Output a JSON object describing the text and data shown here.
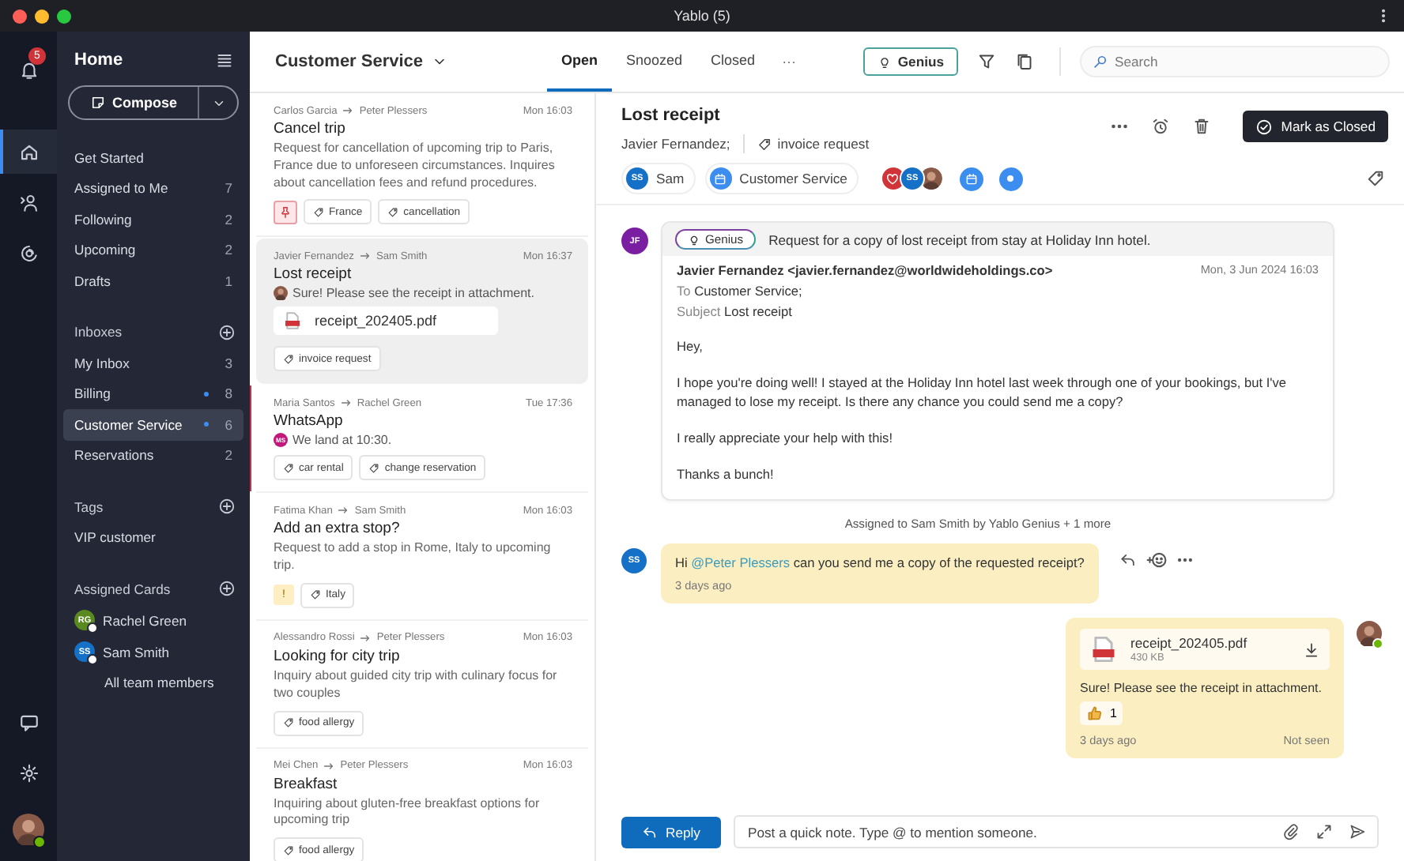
{
  "window": {
    "title": "Yablo (5)"
  },
  "rail": {
    "notifications": "5",
    "items": [
      {
        "kind": "home",
        "selected": true
      },
      {
        "kind": "assign",
        "selected": false
      },
      {
        "kind": "at",
        "selected": false
      }
    ]
  },
  "sidebar": {
    "title": "Home",
    "compose": "Compose",
    "nav": [
      {
        "name": "Get Started",
        "selected": false
      },
      {
        "name": "Assigned to Me",
        "count": "7",
        "selected": false
      },
      {
        "name": "Following",
        "count": "2",
        "selected": false
      },
      {
        "name": "Upcoming",
        "count": "2",
        "selected": false
      },
      {
        "name": "Drafts",
        "count": "1",
        "selected": false
      }
    ],
    "inboxes": {
      "title": "Inboxes",
      "items": [
        {
          "name": "My Inbox",
          "count": "3",
          "unread_dot": false,
          "selected": false
        },
        {
          "name": "Billing",
          "count": "8",
          "unread_dot": true,
          "selected": false
        },
        {
          "name": "Customer Service",
          "count": "6",
          "unread_dot": true,
          "selected": true
        },
        {
          "name": "Reservations",
          "count": "2",
          "unread_dot": false,
          "selected": false
        }
      ]
    },
    "tags": {
      "title": "Tags",
      "items": [
        {
          "name": "VIP customer",
          "selected": false
        }
      ]
    },
    "cards": {
      "title": "Assigned Cards",
      "members": [
        {
          "initials": "RG",
          "name": "Rachel Green",
          "color": "#5a8a1f"
        },
        {
          "initials": "SS",
          "name": "Sam Smith",
          "color": "#1570c8"
        }
      ],
      "link": "All team members"
    }
  },
  "toolbar": {
    "inbox": "Customer Service",
    "tabs": [
      {
        "label": "Open",
        "selected": true
      },
      {
        "label": "Snoozed",
        "selected": false
      },
      {
        "label": "Closed",
        "selected": false
      }
    ],
    "more": "···",
    "genius": "Genius",
    "search": {
      "placeholder": "Search"
    }
  },
  "conversations": [
    {
      "from": "Carlos Garcia",
      "to": "Peter Plessers",
      "time": "Mon 16:03",
      "subject": "Cancel trip",
      "preview": "Request for cancellation of upcoming trip to Paris, France due to unforeseen circumstances. Inquires about cancellation fees and refund procedures.",
      "flag": {
        "kind": "pin"
      },
      "tags": [
        "France",
        "cancellation"
      ],
      "selected": false,
      "unread": false
    },
    {
      "from": "Javier Fernandez",
      "to": "Sam Smith",
      "time": "Mon 16:37",
      "subject": "Lost receipt",
      "preview": "Sure! Please see the receipt in attachment.",
      "avatar": {
        "kind": "photo"
      },
      "attachment": "receipt_202405.pdf",
      "tags": [
        "invoice request"
      ],
      "selected": true,
      "unread": false
    },
    {
      "from": "Maria Santos",
      "to": "Rachel Green",
      "time": "Tue 17:36",
      "subject": "WhatsApp",
      "preview": "We land at 10:30.",
      "avatar": {
        "kind": "initials",
        "initials": "MS",
        "color": "#c2187a"
      },
      "tags": [
        "car rental",
        "change reservation"
      ],
      "selected": false,
      "unread": true
    },
    {
      "from": "Fatima Khan",
      "to": "Sam Smith",
      "time": "Mon 16:03",
      "subject": "Add an extra stop?",
      "preview": "Request to add a stop in Rome, Italy to upcoming trip.",
      "flag": {
        "kind": "priority",
        "text": "!"
      },
      "tags": [
        "Italy"
      ],
      "selected": false,
      "unread": false
    },
    {
      "from": "Alessandro Rossi",
      "to": "Peter Plessers",
      "time": "Mon 16:03",
      "subject": "Looking for city trip",
      "preview": "Inquiry about guided city trip with culinary focus for two couples",
      "tags": [
        "food allergy"
      ],
      "selected": false,
      "unread": false
    },
    {
      "from": "Mei Chen",
      "to": "Peter Plessers",
      "time": "Mon 16:03",
      "subject": "Breakfast",
      "preview": "Inquiring about gluten-free breakfast options for upcoming trip",
      "tags": [
        "food allergy"
      ],
      "selected": false,
      "unread": false
    }
  ],
  "detail": {
    "title": "Lost receipt",
    "contact": "Javier Fernandez;",
    "tag": "invoice request",
    "close_button": "Mark as Closed",
    "chips": [
      {
        "kind": "person",
        "initials": "SS",
        "label": "Sam",
        "color": "#1570c8"
      },
      {
        "kind": "inbox",
        "label": "Customer Service"
      }
    ],
    "followers": [
      {
        "kind": "heart"
      },
      {
        "kind": "initials",
        "initials": "SS",
        "color": "#1570c8"
      },
      {
        "kind": "photo"
      }
    ],
    "email": {
      "avatar": {
        "initials": "JF",
        "color": "#7b1fa2"
      },
      "genius": "Genius",
      "summary": "Request for a copy of lost receipt from stay at Holiday Inn hotel.",
      "from": "Javier Fernandez <javier.fernandez@worldwideholdings.co>",
      "date": "Mon, 3 Jun 2024 16:03",
      "to_label": "To",
      "to": "Customer Service;",
      "subject_label": "Subject",
      "subject": "Lost receipt",
      "body": [
        "Hey,",
        "I hope you're doing well! I stayed at the Holiday Inn hotel last week through one of your bookings, but I've managed to lose my receipt. Is there any chance you could send me a copy?",
        "I really appreciate your help with this!",
        "Thanks a bunch!"
      ]
    },
    "activity": "Assigned to Sam Smith by Yablo Genius + 1 more",
    "notes": [
      {
        "kind": "incoming",
        "avatar": {
          "initials": "SS",
          "color": "#1570c8"
        },
        "segments": [
          {
            "kind": "text",
            "text": "Hi"
          },
          {
            "kind": "mention",
            "text": "@Peter Plessers"
          },
          {
            "kind": "text",
            "text": "can you send me a copy of the requested receipt?"
          }
        ],
        "time": "3 days ago"
      },
      {
        "kind": "outgoing",
        "attachment": {
          "name": "receipt_202405.pdf",
          "size": "430 KB"
        },
        "segments": [
          {
            "kind": "text",
            "text": "Sure! Please see the receipt in attachment."
          }
        ],
        "reaction": {
          "count": "1"
        },
        "time": "3 days ago",
        "status": "Not seen"
      }
    ],
    "composer": {
      "reply": "Reply",
      "placeholder": "Post a quick note. Type @ to mention someone."
    }
  }
}
